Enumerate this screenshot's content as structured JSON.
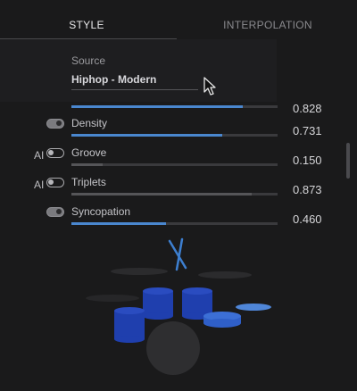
{
  "tabs": [
    {
      "label": "STYLE",
      "active": true
    },
    {
      "label": "INTERPOLATION",
      "active": false
    }
  ],
  "source": {
    "label": "Source",
    "value": "Hiphop - Modern"
  },
  "clipped_slider": {
    "value_text": "0.828",
    "value": 0.828
  },
  "sliders": [
    {
      "label": "Density",
      "value": 0.731,
      "value_text": "0.731",
      "ai_label": "",
      "toggle_on": true,
      "fill_active": true
    },
    {
      "label": "Groove",
      "value": 0.15,
      "value_text": "0.150",
      "ai_label": "AI",
      "toggle_on": false,
      "fill_active": false
    },
    {
      "label": "Triplets",
      "value": 0.873,
      "value_text": "0.873",
      "ai_label": "AI",
      "toggle_on": false,
      "fill_active": false
    },
    {
      "label": "Syncopation",
      "value": 0.46,
      "value_text": "0.460",
      "ai_label": "",
      "toggle_on": true,
      "fill_active": true
    }
  ],
  "colors": {
    "accent": "#4a87cf",
    "drum_blue": "#1f3fae",
    "background": "#1a1a1b"
  }
}
